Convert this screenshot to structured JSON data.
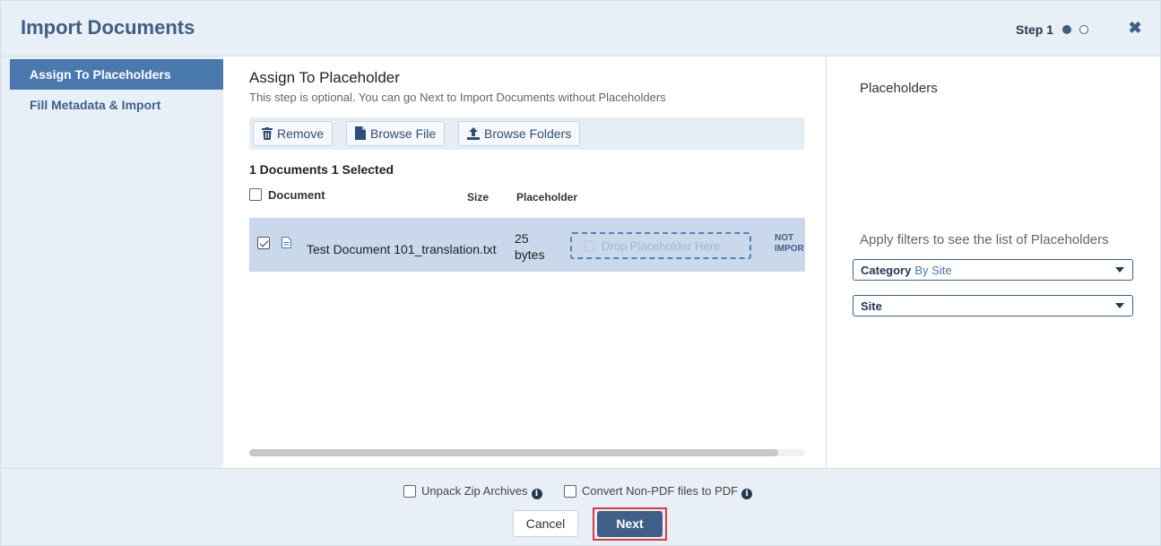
{
  "header": {
    "title": "Import Documents",
    "step_label": "Step 1",
    "close_icon": "close-icon"
  },
  "sidebar": {
    "items": [
      {
        "label": "Assign To Placeholders",
        "active": true
      },
      {
        "label": "Fill Metadata & Import",
        "active": false
      }
    ]
  },
  "main": {
    "title": "Assign To Placeholder",
    "subtitle": "This step is optional. You can go Next to Import Documents without Placeholders",
    "toolbar": {
      "remove_label": "Remove",
      "browse_file_label": "Browse File",
      "browse_folders_label": "Browse Folders"
    },
    "count_label": "1 Documents 1 Selected",
    "columns": {
      "document": "Document",
      "size": "Size",
      "placeholder": "Placeholder"
    },
    "rows": [
      {
        "checked": true,
        "document": "Test Document 101_translation.txt",
        "size": "25 bytes",
        "drop_placeholder": "Drop Placeholder Here",
        "status": "NOT IMPOR"
      }
    ]
  },
  "right_panel": {
    "title": "Placeholders",
    "hint": "Apply filters to see the list of Placeholders",
    "filters": [
      {
        "label": "Category",
        "value": "By Site"
      },
      {
        "label": "Site",
        "value": ""
      }
    ]
  },
  "footer": {
    "unpack_zip_label": "Unpack Zip Archives",
    "convert_pdf_label": "Convert Non-PDF files to PDF",
    "cancel_label": "Cancel",
    "next_label": "Next"
  },
  "colors": {
    "brand": "#3f5f86",
    "nav_active": "#4a79ad",
    "panel_bg": "#e9eff6",
    "row_selected": "#c9d8ea",
    "highlight": "#e03b3b"
  }
}
